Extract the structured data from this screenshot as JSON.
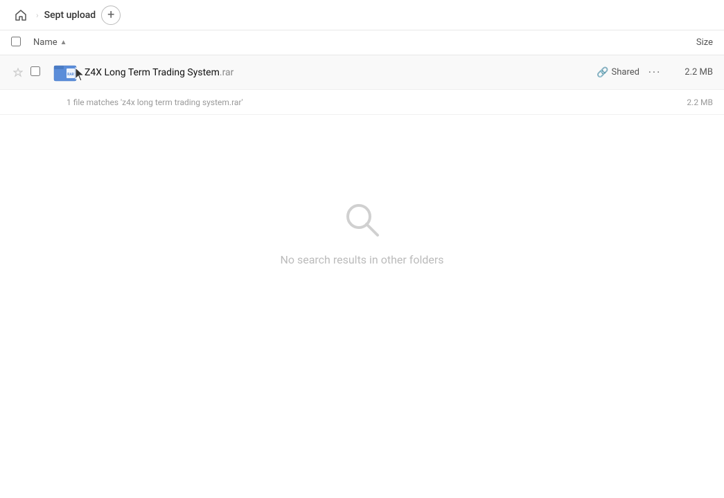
{
  "topbar": {
    "home_label": "Home",
    "breadcrumb": "Sept upload",
    "add_btn_label": "+"
  },
  "columns": {
    "name_label": "Name",
    "sort_indicator": "▲",
    "size_label": "Size"
  },
  "file": {
    "name_base": "Z4X Long Term Trading System",
    "name_ext": ".rar",
    "shared_label": "Shared",
    "more_label": "···",
    "size": "2.2 MB",
    "match_text": "1 file matches 'z4x long term trading system.rar'",
    "match_size": "2.2 MB"
  },
  "empty_state": {
    "text": "No search results in other folders"
  }
}
